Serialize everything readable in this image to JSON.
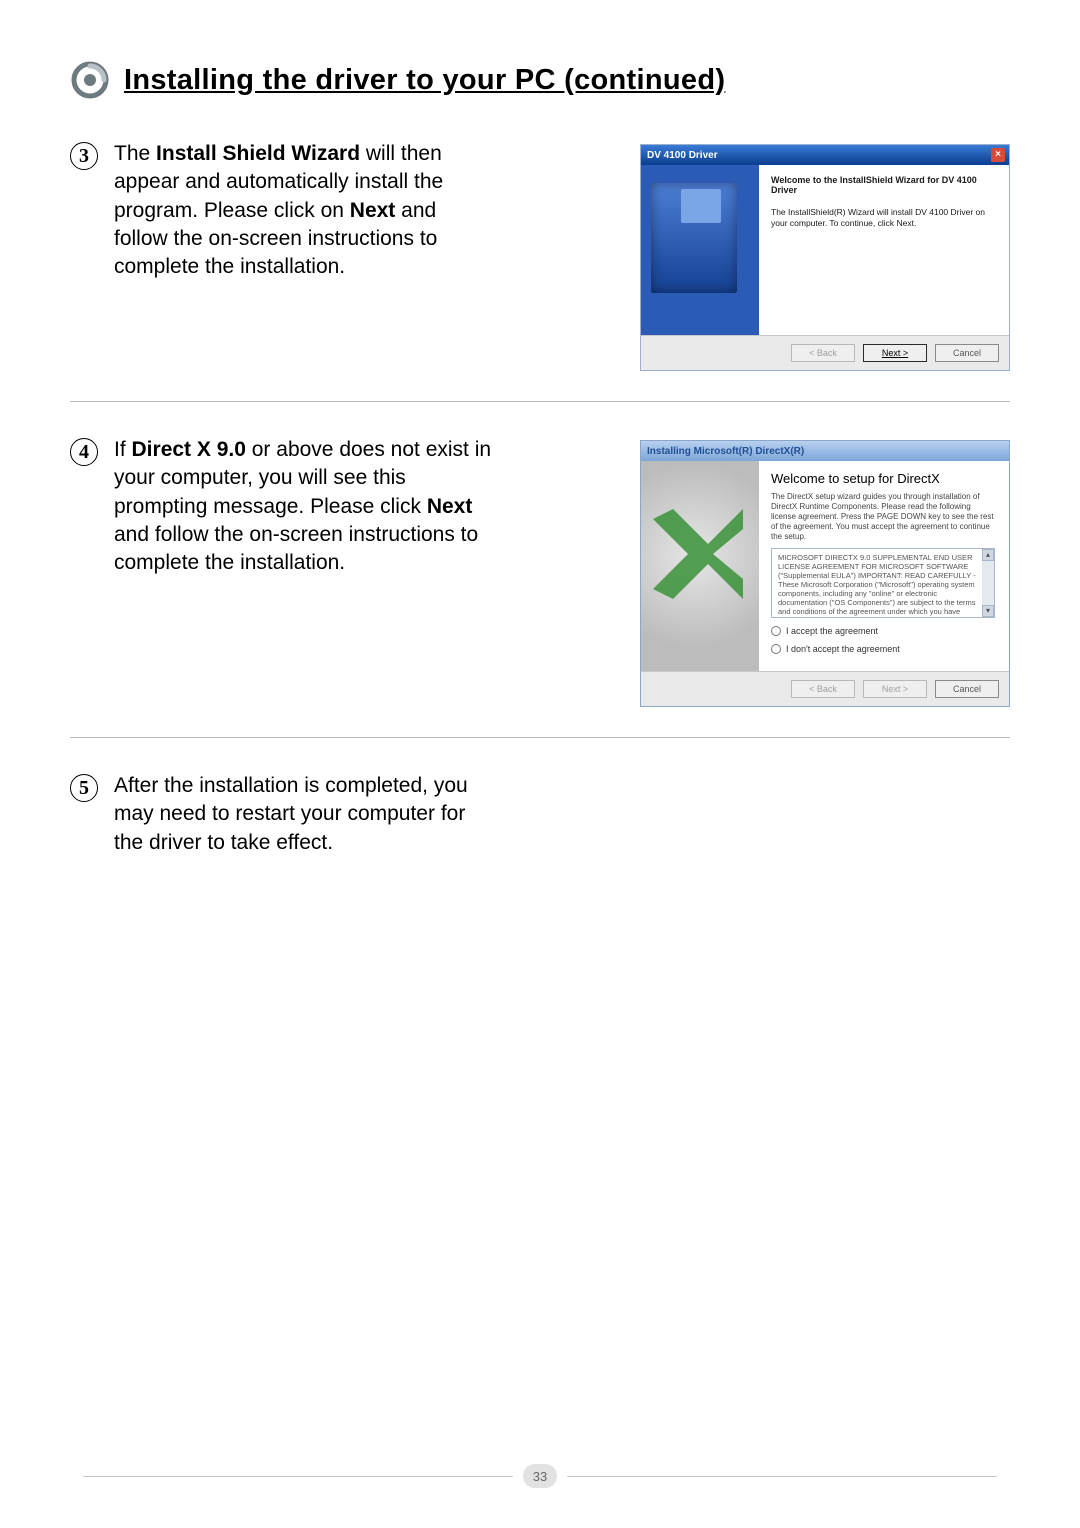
{
  "page_title": "Installing the driver to your PC (continued)",
  "page_number": "33",
  "steps": {
    "s3": {
      "num": "3",
      "text_pre": "The ",
      "text_b1": "Install Shield Wizard",
      "text_mid1": " will then appear and automatically install the program. Please click on ",
      "text_b2": "Next",
      "text_post": " and follow the on-screen instructions to complete the installation."
    },
    "s4": {
      "num": "4",
      "text_pre": "If ",
      "text_b1": "Direct X 9.0",
      "text_mid1": " or above does not exist in your computer, you will see this prompting message. Please click ",
      "text_b2": "Next",
      "text_post": " and follow the on-screen instructions to complete the installation."
    },
    "s5": {
      "num": "5",
      "text": "After the installation is completed, you may need to restart your computer for the driver to take effect."
    }
  },
  "shot1": {
    "title": "DV 4100 Driver",
    "heading": "Welcome to the InstallShield Wizard for DV 4100 Driver",
    "desc": "The InstallShield(R) Wizard will install DV 4100 Driver on your computer. To continue, click Next.",
    "btn_back": "< Back",
    "btn_next": "Next >",
    "btn_cancel": "Cancel",
    "close": "×"
  },
  "shot2": {
    "title": "Installing Microsoft(R) DirectX(R)",
    "heading": "Welcome to setup for DirectX",
    "desc": "The DirectX setup wizard guides you through installation of DirectX Runtime Components. Please read the following license agreement. Press the PAGE DOWN key to see the rest of the agreement. You must accept the agreement to continue the setup.",
    "eula": "MICROSOFT DIRECTX 9.0 SUPPLEMENTAL END USER LICENSE AGREEMENT FOR MICROSOFT SOFTWARE (\"Supplemental EULA\") IMPORTANT: READ CAREFULLY - These Microsoft Corporation (\"Microsoft\") operating system components, including any \"online\" or electronic documentation (\"OS Components\") are subject to the terms and conditions of the agreement under which you have licensed the applicable Microsoft operating system product described",
    "radio_accept": "I accept the agreement",
    "radio_reject": "I don't accept the agreement",
    "btn_back": "< Back",
    "btn_next": "Next >",
    "btn_cancel": "Cancel"
  }
}
